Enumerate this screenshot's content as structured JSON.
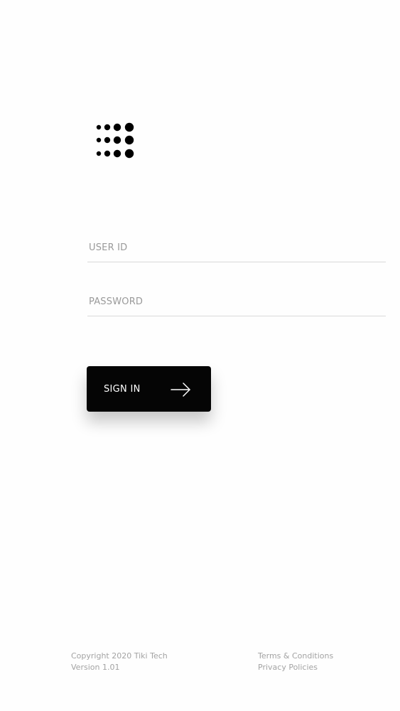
{
  "logo": {
    "icon": "dot-grid-logo-icon",
    "color": "#000000"
  },
  "form": {
    "user_id": {
      "placeholder": "USER ID",
      "value": ""
    },
    "password": {
      "placeholder": "PASSWORD",
      "value": ""
    }
  },
  "sign_in_button": {
    "label": "SIGN IN",
    "icon": "arrow-right-icon",
    "background": "#050505",
    "text_color": "#ffffff"
  },
  "footer": {
    "copyright": "Copyright 2020 Tiki Tech",
    "version": "Version 1.01",
    "terms_label": "Terms & Conditions",
    "privacy_label": "Privacy Policies",
    "text_color": "#a3a3a3"
  }
}
